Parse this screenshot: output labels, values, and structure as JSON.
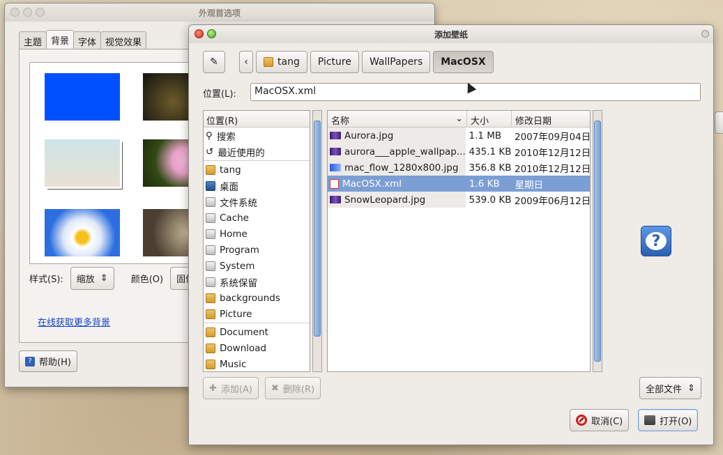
{
  "appearance": {
    "title": "外观首选项",
    "tabs": [
      "主题",
      "背景",
      "字体",
      "视觉效果"
    ],
    "style_label": "样式(S):",
    "style_value": "缩放",
    "color_label": "颜色(O)",
    "color_value": "固体",
    "online_link": "在线获取更多背景",
    "help_button": "帮助(H)",
    "accent": "#1543c6"
  },
  "chooser": {
    "title": "添加壁纸",
    "path_buttons": [
      "tang",
      "Picture",
      "WallPapers",
      "MacOSX"
    ],
    "location_label": "位置(L):",
    "location_value": "MacOSX.xml",
    "places_header": "位置(R)",
    "places": [
      {
        "label": "搜索",
        "icon": "search-icon"
      },
      {
        "label": "最近使用的",
        "icon": "recent-icon"
      },
      {
        "label": "tang",
        "icon": "home-folder-icon"
      },
      {
        "label": "桌面",
        "icon": "desktop-icon"
      },
      {
        "label": "文件系统",
        "icon": "drive-icon"
      },
      {
        "label": "Cache",
        "icon": "drive-icon"
      },
      {
        "label": "Home",
        "icon": "drive-icon"
      },
      {
        "label": "Program",
        "icon": "drive-icon"
      },
      {
        "label": "System",
        "icon": "drive-icon"
      },
      {
        "label": "系统保留",
        "icon": "drive-icon"
      },
      {
        "label": "backgrounds",
        "icon": "folder-icon"
      },
      {
        "label": "Picture",
        "icon": "pictures-folder-icon"
      },
      {
        "label": "Document",
        "icon": "documents-folder-icon"
      },
      {
        "label": "Download",
        "icon": "download-folder-icon"
      },
      {
        "label": "Music",
        "icon": "music-folder-icon"
      }
    ],
    "columns": {
      "name": "名称",
      "size": "大小",
      "modified": "修改日期"
    },
    "files": [
      {
        "name": "Aurora.jpg",
        "size": "1.1 MB",
        "modified": "2007年09月04日",
        "selected": false
      },
      {
        "name": "aurora___apple_wallpap...",
        "size": "435.1 KB",
        "modified": "2010年12月12日",
        "selected": false
      },
      {
        "name": "mac_flow_1280x800.jpg",
        "size": "356.8 KB",
        "modified": "2010年12月12日",
        "selected": false
      },
      {
        "name": "MacOSX.xml",
        "size": "1.6 KB",
        "modified": "星期日",
        "selected": true
      },
      {
        "name": "SnowLeopard.jpg",
        "size": "539.0 KB",
        "modified": "2009年06月12日",
        "selected": false
      }
    ],
    "add_button": "添加(A)",
    "remove_button": "删除(R)",
    "filter_value": "全部文件",
    "cancel_button": "取消(C)",
    "open_button": "打开(O)",
    "selection_color": "#7b9ed4"
  }
}
